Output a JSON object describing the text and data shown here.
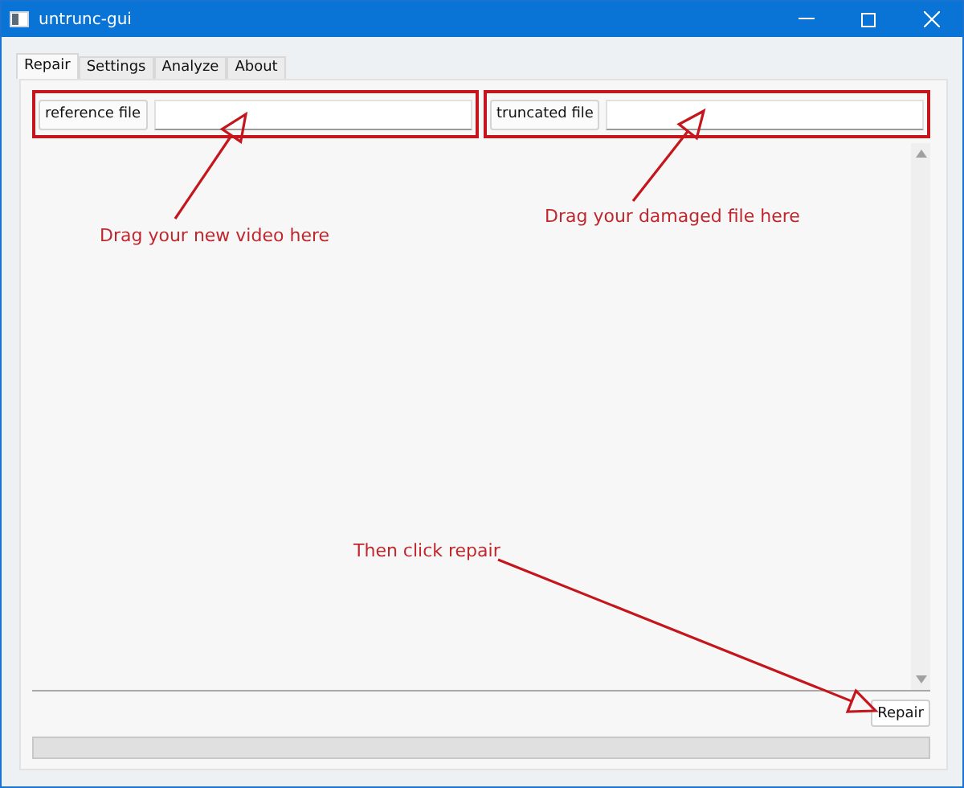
{
  "window": {
    "title": "untrunc-gui"
  },
  "tabs": [
    {
      "label": "Repair",
      "selected": true
    },
    {
      "label": "Settings",
      "selected": false
    },
    {
      "label": "Analyze",
      "selected": false
    },
    {
      "label": "About",
      "selected": false
    }
  ],
  "file_fields": [
    {
      "button": "reference file"
    },
    {
      "button": "truncated file"
    }
  ],
  "repair_button": "Repair",
  "progress": {
    "level": 0
  },
  "annotations": [
    {
      "text": "Drag your new video here"
    },
    {
      "text": "Drag your damaged file here"
    },
    {
      "text": "Then click repair"
    }
  ]
}
